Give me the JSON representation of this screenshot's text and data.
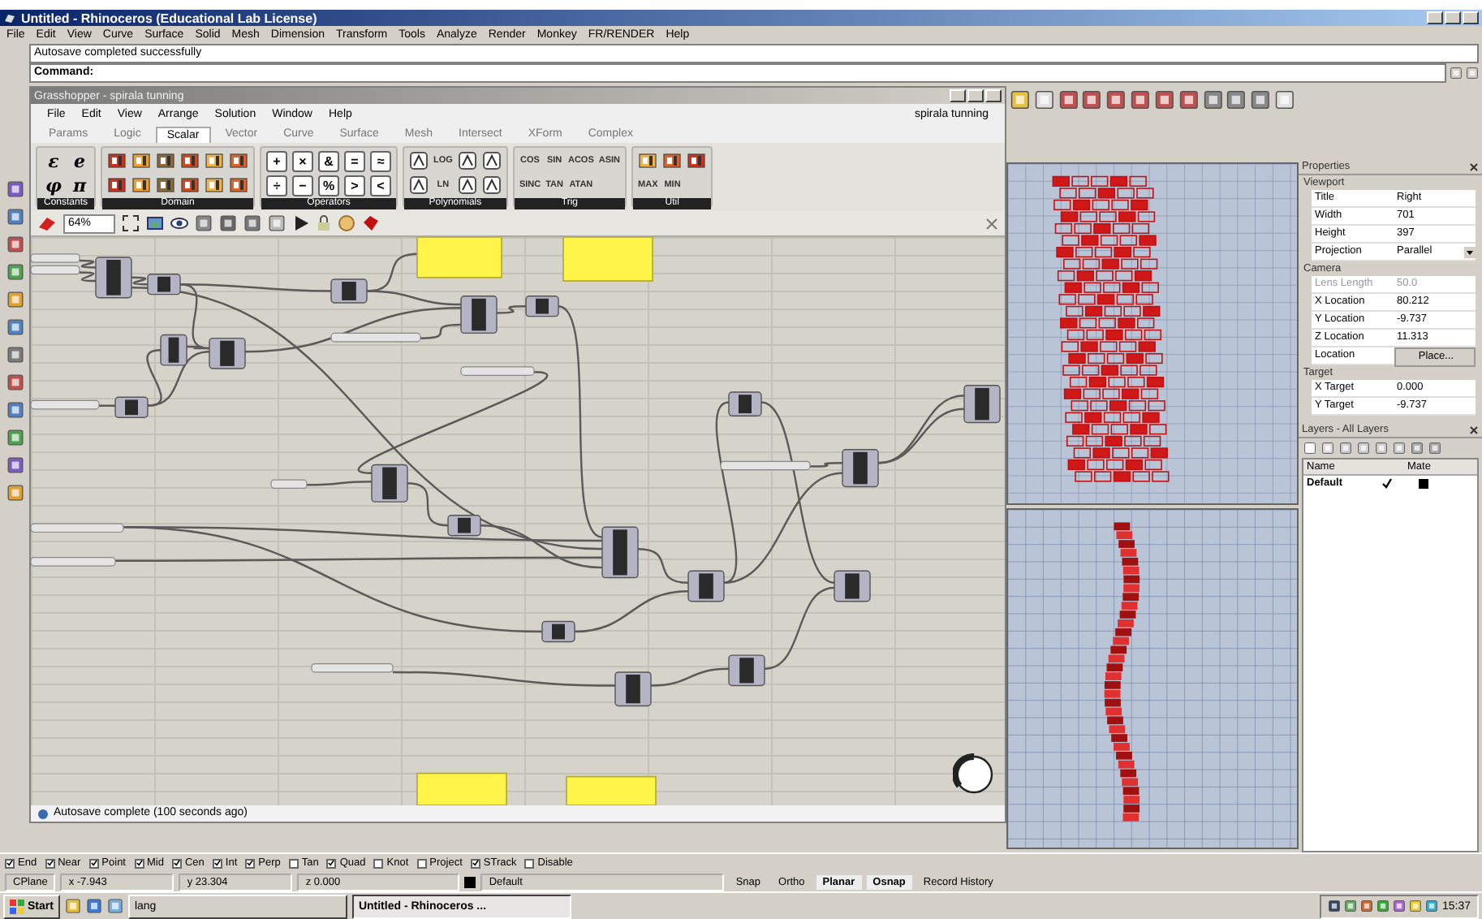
{
  "window": {
    "title": "Untitled - Rhinoceros (Educational Lab License)"
  },
  "menu": [
    "File",
    "Edit",
    "View",
    "Curve",
    "Surface",
    "Solid",
    "Mesh",
    "Dimension",
    "Transform",
    "Tools",
    "Analyze",
    "Render",
    "Monkey",
    "FR/RENDER",
    "Help"
  ],
  "command": {
    "history": "Autosave completed successfully",
    "prompt": "Command:"
  },
  "grasshopper": {
    "title": "Grasshopper - spirala tunning",
    "menu": [
      "File",
      "Edit",
      "View",
      "Arrange",
      "Solution",
      "Window",
      "Help"
    ],
    "document": "spirala tunning",
    "tabs": [
      {
        "label": "Params",
        "selected": false
      },
      {
        "label": "Logic",
        "selected": false
      },
      {
        "label": "Scalar",
        "selected": true
      },
      {
        "label": "Vector",
        "selected": false
      },
      {
        "label": "Curve",
        "selected": false
      },
      {
        "label": "Surface",
        "selected": false
      },
      {
        "label": "Mesh",
        "selected": false
      },
      {
        "label": "Intersect",
        "selected": false
      },
      {
        "label": "XForm",
        "selected": false
      },
      {
        "label": "Complex",
        "selected": false
      }
    ],
    "ribbon": [
      {
        "label": "Constants",
        "items": [
          {
            "kind": "symbol",
            "text": "ε"
          },
          {
            "kind": "symbol",
            "text": "e"
          },
          {
            "kind": "symbol",
            "text": "φ"
          },
          {
            "kind": "symbol",
            "text": "π"
          }
        ]
      },
      {
        "label": "Domain",
        "items": [
          {
            "kind": "icon"
          },
          {
            "kind": "icon"
          },
          {
            "kind": "icon"
          },
          {
            "kind": "icon"
          },
          {
            "kind": "icon"
          },
          {
            "kind": "icon"
          },
          {
            "kind": "icon"
          },
          {
            "kind": "icon"
          },
          {
            "kind": "icon"
          },
          {
            "kind": "icon"
          },
          {
            "kind": "icon"
          },
          {
            "kind": "icon"
          }
        ]
      },
      {
        "label": "Operators",
        "items": [
          {
            "kind": "key",
            "text": "+"
          },
          {
            "kind": "key",
            "text": "×"
          },
          {
            "kind": "key",
            "text": "&"
          },
          {
            "kind": "key",
            "text": "="
          },
          {
            "kind": "key",
            "text": "≈"
          },
          {
            "kind": "key",
            "text": "÷"
          },
          {
            "kind": "key",
            "text": "−"
          },
          {
            "kind": "key",
            "text": "%"
          },
          {
            "kind": "key",
            "text": ">"
          },
          {
            "kind": "key",
            "text": "<"
          }
        ]
      },
      {
        "label": "Polynomials",
        "items": [
          {
            "kind": "icon"
          },
          {
            "kind": "word",
            "text": "LOG"
          },
          {
            "kind": "icon"
          },
          {
            "kind": "icon"
          },
          {
            "kind": "icon"
          },
          {
            "kind": "word",
            "text": "LN"
          },
          {
            "kind": "icon"
          },
          {
            "kind": "icon"
          }
        ]
      },
      {
        "label": "Trig",
        "items": [
          {
            "kind": "word",
            "text": "COS"
          },
          {
            "kind": "word",
            "text": "SIN"
          },
          {
            "kind": "word",
            "text": "ACOS"
          },
          {
            "kind": "word",
            "text": "ASIN"
          },
          {
            "kind": "word",
            "text": "SINC"
          },
          {
            "kind": "word",
            "text": "TAN"
          },
          {
            "kind": "word",
            "text": "ATAN"
          }
        ]
      },
      {
        "label": "Util",
        "items": [
          {
            "kind": "icon"
          },
          {
            "kind": "icon"
          },
          {
            "kind": "icon"
          },
          {
            "kind": "word",
            "text": "MAX"
          },
          {
            "kind": "word",
            "text": "MIN"
          }
        ]
      }
    ],
    "zoom": "64%",
    "status": "Autosave complete (100 seconds ago)"
  },
  "properties": {
    "title": "Properties",
    "sections": [
      {
        "title": "Viewport",
        "rows": [
          {
            "label": "Title",
            "value": "Right",
            "kind": "text",
            "disabled": false
          },
          {
            "label": "Width",
            "value": "701",
            "kind": "text",
            "disabled": false
          },
          {
            "label": "Height",
            "value": "397",
            "kind": "text",
            "disabled": false
          },
          {
            "label": "Projection",
            "value": "Parallel",
            "kind": "dropdown",
            "disabled": false
          }
        ]
      },
      {
        "title": "Camera",
        "rows": [
          {
            "label": "Lens Length",
            "value": "50.0",
            "kind": "text",
            "disabled": true
          },
          {
            "label": "X Location",
            "value": "80.212",
            "kind": "text",
            "disabled": false
          },
          {
            "label": "Y Location",
            "value": "-9.737",
            "kind": "text",
            "disabled": false
          },
          {
            "label": "Z Location",
            "value": "11.313",
            "kind": "text",
            "disabled": false
          },
          {
            "label": "Location",
            "value": "Place...",
            "kind": "button",
            "disabled": false
          }
        ]
      },
      {
        "title": "Target",
        "rows": [
          {
            "label": "X Target",
            "value": "0.000",
            "kind": "text",
            "disabled": false
          },
          {
            "label": "Y Target",
            "value": "-9.737",
            "kind": "text",
            "disabled": false
          }
        ]
      }
    ]
  },
  "layers": {
    "title": "Layers - All Layers",
    "columns": [
      "Name",
      "Mate"
    ],
    "items": [
      {
        "name": "Default",
        "current": true,
        "color": "#000000"
      }
    ]
  },
  "osnap": [
    {
      "label": "End",
      "checked": true
    },
    {
      "label": "Near",
      "checked": true
    },
    {
      "label": "Point",
      "checked": true
    },
    {
      "label": "Mid",
      "checked": true
    },
    {
      "label": "Cen",
      "checked": true
    },
    {
      "label": "Int",
      "checked": true
    },
    {
      "label": "Perp",
      "checked": true
    },
    {
      "label": "Tan",
      "checked": false
    },
    {
      "label": "Quad",
      "checked": true
    },
    {
      "label": "Knot",
      "checked": false
    },
    {
      "label": "Project",
      "checked": false
    },
    {
      "label": "STrack",
      "checked": true
    },
    {
      "label": "Disable",
      "checked": false
    }
  ],
  "status_bar": {
    "cplane": "CPlane",
    "x": "x -7.943",
    "y": "y 23.304",
    "z": "z 0.000",
    "layer": "Default",
    "toggles": [
      {
        "label": "Snap",
        "on": false
      },
      {
        "label": "Ortho",
        "on": false
      },
      {
        "label": "Planar",
        "on": true
      },
      {
        "label": "Osnap",
        "on": true
      },
      {
        "label": "Record History",
        "on": false
      }
    ]
  },
  "taskbar": {
    "start": "Start",
    "tasks": [
      {
        "label": "lang",
        "selected": false
      },
      {
        "label": "Untitled - Rhinoceros ...",
        "selected": true
      }
    ],
    "clock": "15:37"
  }
}
